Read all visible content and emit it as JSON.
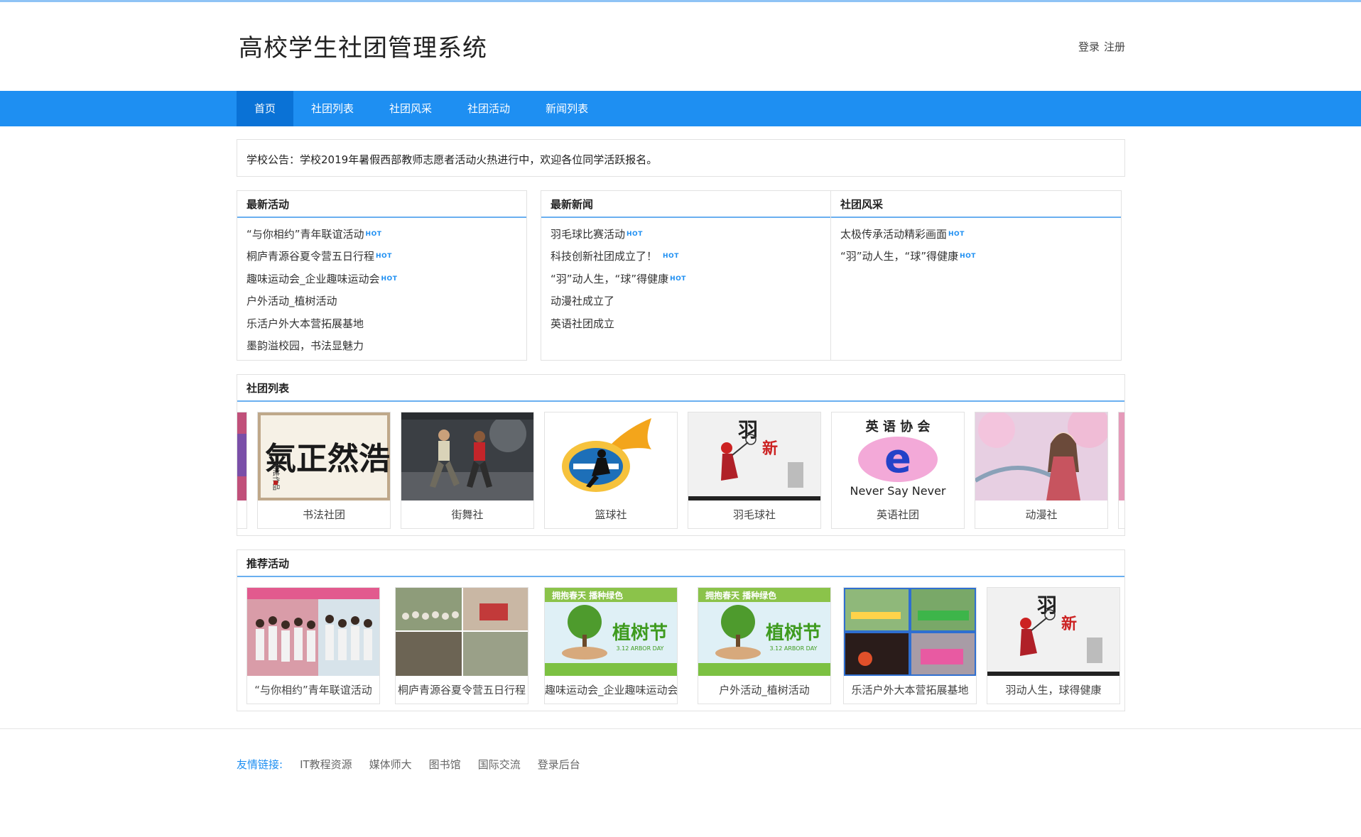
{
  "header": {
    "title": "高校学生社团管理系统",
    "login": "登录",
    "register": "注册"
  },
  "nav": {
    "items": [
      "首页",
      "社团列表",
      "社团风采",
      "社团活动",
      "新闻列表"
    ],
    "active_index": 0
  },
  "notice": {
    "label": "学校公告：",
    "text": "学校2019年暑假西部教师志愿者活动火热进行中，欢迎各位同学活跃报名。"
  },
  "latest_activities": {
    "title": "最新活动",
    "items": [
      {
        "text": "“与你相约”青年联谊活动",
        "hot": "HOT"
      },
      {
        "text": "桐庐青源谷夏令营五日行程",
        "hot": "HOT"
      },
      {
        "text": "趣味运动会_企业趣味运动会",
        "hot": "HOT"
      },
      {
        "text": "户外活动_植树活动",
        "hot": ""
      },
      {
        "text": "乐活户外大本营拓展基地",
        "hot": ""
      },
      {
        "text": "墨韵溢校园，书法显魅力",
        "hot": ""
      }
    ]
  },
  "latest_news": {
    "title": "最新新闻",
    "items": [
      {
        "text": "羽毛球比赛活动",
        "hot": "HOT"
      },
      {
        "text": "科技创新社团成立了！",
        "hot": "HOT"
      },
      {
        "text": "“羽”动人生，“球”得健康",
        "hot": "HOT"
      },
      {
        "text": "动漫社成立了",
        "hot": ""
      },
      {
        "text": "英语社团成立",
        "hot": ""
      }
    ]
  },
  "club_style": {
    "title": "社团风采",
    "items": [
      {
        "text": "太极传承活动精彩画面",
        "hot": "HOT"
      },
      {
        "text": "“羽”动人生，“球”得健康",
        "hot": "HOT"
      }
    ]
  },
  "club_list": {
    "title": "社团列表",
    "items": [
      {
        "name": "书法社团",
        "image": "calligraphy"
      },
      {
        "name": "街舞社",
        "image": "street-dance"
      },
      {
        "name": "篮球社",
        "image": "basketball-logo"
      },
      {
        "name": "羽毛球社",
        "image": "badminton-poster"
      },
      {
        "name": "英语社团",
        "image": "english-association-logo"
      },
      {
        "name": "动漫社",
        "image": "anime-girl"
      }
    ]
  },
  "recommended": {
    "title": "推荐活动",
    "items": [
      {
        "name": "“与你相约”青年联谊活动",
        "image": "group-photo"
      },
      {
        "name": "桐庐青源谷夏令营五日行程",
        "image": "summer-camp"
      },
      {
        "name": "趣味运动会_企业趣味运动会",
        "image": "arbor-day"
      },
      {
        "name": "户外活动_植树活动",
        "image": "arbor-day"
      },
      {
        "name": "乐活户外大本营拓展基地",
        "image": "outdoor-base"
      },
      {
        "name": "羽动人生，球得健康",
        "image": "badminton-poster"
      }
    ]
  },
  "footer": {
    "label": "友情链接:",
    "links": [
      "IT教程资源",
      "媒体师大",
      "图书馆",
      "国际交流",
      "登录后台"
    ]
  },
  "colors": {
    "nav_bg": "#1e8ff2",
    "nav_active": "#0a72d6",
    "accent": "#1e8ff2",
    "panel_underline": "#6aaff0"
  }
}
